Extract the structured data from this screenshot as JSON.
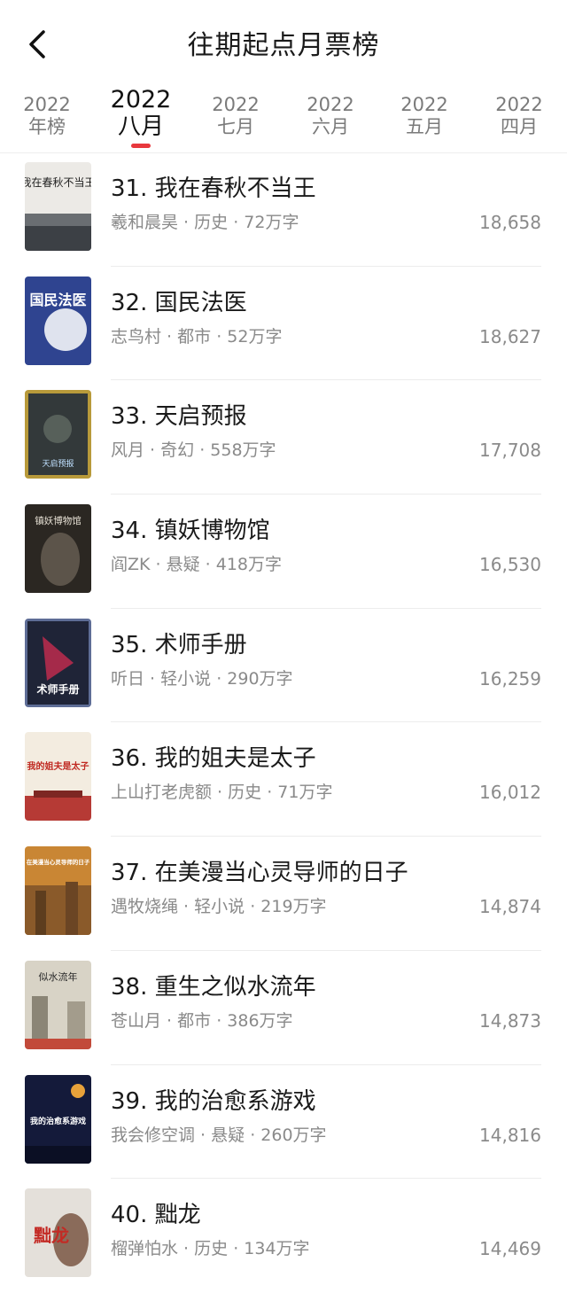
{
  "header": {
    "title": "往期起点月票榜",
    "back_icon": "chevron-left-icon"
  },
  "tabs": [
    {
      "year": "2022",
      "label": "年榜",
      "active": false
    },
    {
      "year": "2022",
      "label": "八月",
      "active": true
    },
    {
      "year": "2022",
      "label": "七月",
      "active": false
    },
    {
      "year": "2022",
      "label": "六月",
      "active": false
    },
    {
      "year": "2022",
      "label": "五月",
      "active": false
    },
    {
      "year": "2022",
      "label": "四月",
      "active": false
    }
  ],
  "accent_color": "#e8383d",
  "books": [
    {
      "title": "31. 我在春秋不当王",
      "author": "羲和晨昊",
      "genre": "历史",
      "words": "72万字",
      "votes": "18,658",
      "cover_text": "我在春秋不当王"
    },
    {
      "title": "32. 国民法医",
      "author": "志鸟村",
      "genre": "都市",
      "words": "52万字",
      "votes": "18,627",
      "cover_text": "国民法医"
    },
    {
      "title": "33. 天启预报",
      "author": "风月",
      "genre": "奇幻",
      "words": "558万字",
      "votes": "17,708",
      "cover_text": "天启预报"
    },
    {
      "title": "34. 镇妖博物馆",
      "author": "阎ZK",
      "genre": "悬疑",
      "words": "418万字",
      "votes": "16,530",
      "cover_text": "镇妖博物馆"
    },
    {
      "title": "35. 术师手册",
      "author": "听日",
      "genre": "轻小说",
      "words": "290万字",
      "votes": "16,259",
      "cover_text": "术师手册"
    },
    {
      "title": "36. 我的姐夫是太子",
      "author": "上山打老虎额",
      "genre": "历史",
      "words": "71万字",
      "votes": "16,012",
      "cover_text": "我的姐夫是太子"
    },
    {
      "title": "37. 在美漫当心灵导师的日子",
      "author": "遇牧烧绳",
      "genre": "轻小说",
      "words": "219万字",
      "votes": "14,874",
      "cover_text": "在美漫当心灵导师的日子"
    },
    {
      "title": "38. 重生之似水流年",
      "author": "苍山月",
      "genre": "都市",
      "words": "386万字",
      "votes": "14,873",
      "cover_text": "似水流年"
    },
    {
      "title": "39. 我的治愈系游戏",
      "author": "我会修空调",
      "genre": "悬疑",
      "words": "260万字",
      "votes": "14,816",
      "cover_text": "我的治愈系游戏"
    },
    {
      "title": "40. 黜龙",
      "author": "榴弹怕水",
      "genre": "历史",
      "words": "134万字",
      "votes": "14,469",
      "cover_text": "黜龙"
    }
  ]
}
